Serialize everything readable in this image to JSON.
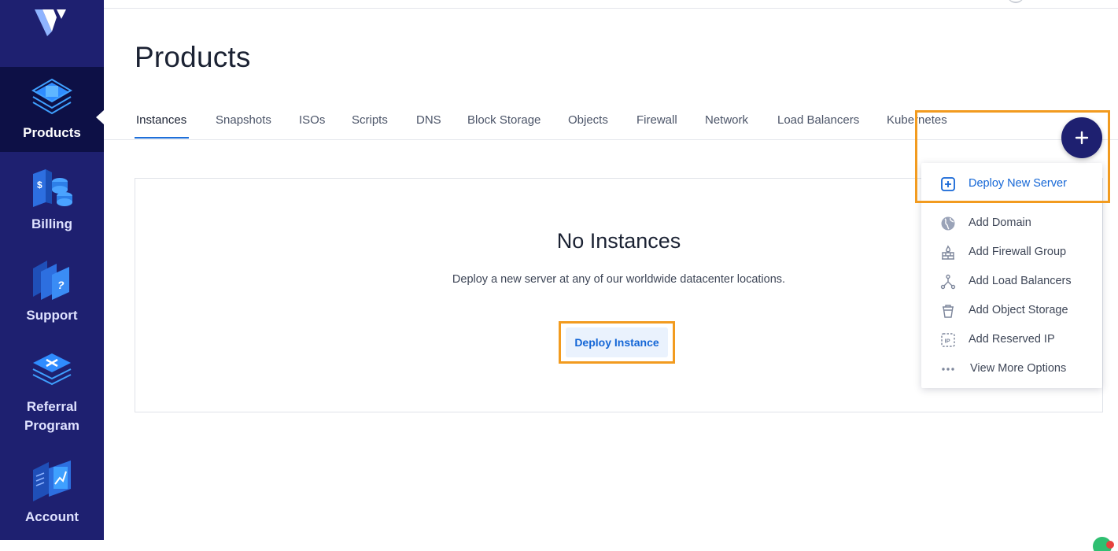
{
  "sidebar": {
    "items": [
      {
        "label": "Products",
        "icon": "products-icon"
      },
      {
        "label": "Billing",
        "icon": "billing-icon"
      },
      {
        "label": "Support",
        "icon": "support-icon"
      },
      {
        "label": "Referral\nProgram",
        "icon": "referral-icon"
      },
      {
        "label": "Account",
        "icon": "account-icon"
      }
    ],
    "active": "Products"
  },
  "page": {
    "title": "Products"
  },
  "tabs": [
    {
      "label": "Instances"
    },
    {
      "label": "Snapshots"
    },
    {
      "label": "ISOs"
    },
    {
      "label": "Scripts"
    },
    {
      "label": "DNS"
    },
    {
      "label": "Block Storage"
    },
    {
      "label": "Objects"
    },
    {
      "label": "Firewall"
    },
    {
      "label": "Network"
    },
    {
      "label": "Load Balancers"
    },
    {
      "label": "Kubernetes"
    }
  ],
  "empty_state": {
    "title": "No Instances",
    "description": "Deploy a new server at any of our worldwide datacenter locations.",
    "button": "Deploy Instance"
  },
  "fab": {
    "symbol": "+"
  },
  "dropdown": {
    "items": [
      {
        "label": "Deploy New Server",
        "icon": "plus-square-icon"
      },
      {
        "label": "Add Domain",
        "icon": "globe-icon"
      },
      {
        "label": "Add Firewall Group",
        "icon": "firewall-icon"
      },
      {
        "label": "Add Load Balancers",
        "icon": "load-balancer-icon"
      },
      {
        "label": "Add Object Storage",
        "icon": "bucket-icon"
      },
      {
        "label": "Add Reserved IP",
        "icon": "ip-icon"
      },
      {
        "label": "View More Options",
        "icon": "more-dots-icon"
      }
    ]
  },
  "colors": {
    "sidebar": "#1e2070",
    "sidebar_active": "#0d1046",
    "accent": "#1466d6",
    "highlight": "#f29b1f"
  }
}
